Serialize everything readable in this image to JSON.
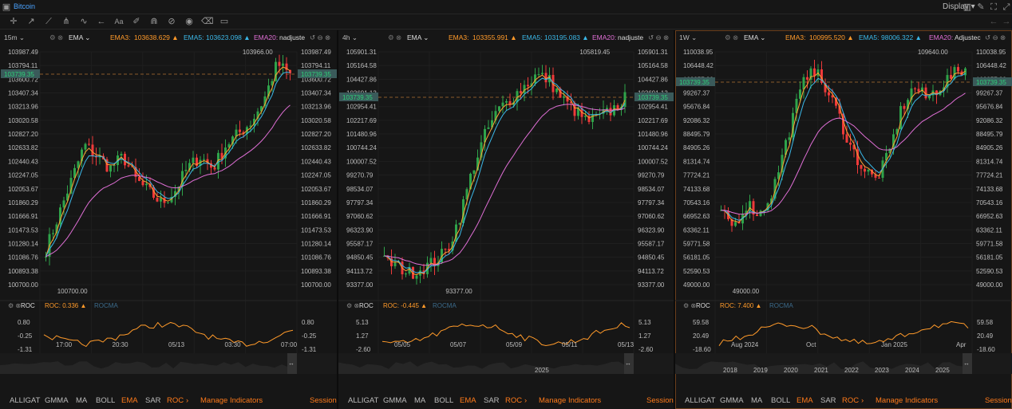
{
  "app": {
    "title": "Bitcoin",
    "display_label": "Display"
  },
  "colors": {
    "up": "#2fa44a",
    "down": "#ef3a3a",
    "ema3": "#ffa033",
    "ema5": "#3bb8e8",
    "ema20": "#e06fd6",
    "roc": "#ff9a2a",
    "accent": "#ff7a1a"
  },
  "toolbar_icons": [
    "crosshair-icon",
    "drag-icon",
    "trend-line-icon",
    "fork-icon",
    "zigzag-icon",
    "arrow-icon",
    "text-icon",
    "brush-icon",
    "magnet-icon",
    "lock-icon",
    "eye-icon",
    "trash-icon",
    "layers-icon"
  ],
  "bottom_items": [
    "ALLIGAT",
    "GMMA",
    "MA",
    "BOLL",
    "EMA",
    "SAR",
    "ROC",
    "›",
    "Manage Indicators",
    "Session"
  ],
  "panels": [
    {
      "timeframe": "15m",
      "ind_label": "EMA",
      "ema3": "EMA3:",
      "ema3v": "103638.629",
      "ema5": "EMA5:",
      "ema5v": "103623.098",
      "ema20": "EMA20:",
      "ema20v": "nadjuste",
      "prices": [
        "103987.49",
        "103794.11",
        "103600.72",
        "103407.34",
        "103213.96",
        "103020.58",
        "102827.20",
        "102633.82",
        "102440.43",
        "102247.05",
        "102053.67",
        "101860.29",
        "101666.91",
        "101473.53",
        "101280.14",
        "101086.76",
        "100893.38",
        "100700.00"
      ],
      "last_price": "103739.35",
      "high_label": "103966.00",
      "low_label": "100700.00",
      "roc_label": "ROC",
      "roc_v": "ROC: 0.336",
      "rocma": "ROCMA",
      "roc_ticks": [
        "0.80",
        "-0.25",
        "-1.31"
      ],
      "time_ticks": [
        "17:00",
        "20:30",
        "05/13",
        "03:30",
        "07:00"
      ],
      "year_ticks": []
    },
    {
      "timeframe": "4h",
      "ind_label": "EMA",
      "ema3": "EMA3:",
      "ema3v": "103355.991",
      "ema5": "EMA5:",
      "ema5v": "103195.083",
      "ema20": "EMA20:",
      "ema20v": "nadjuste",
      "prices": [
        "105901.31",
        "105164.58",
        "104427.86",
        "103691.13",
        "102954.41",
        "102217.69",
        "101480.96",
        "100744.24",
        "100007.52",
        "99270.79",
        "98534.07",
        "97797.34",
        "97060.62",
        "96323.90",
        "95587.17",
        "94850.45",
        "94113.72",
        "93377.00"
      ],
      "last_price": "103739.35",
      "high_label": "105819.45",
      "low_label": "93377.00",
      "roc_label": "ROC",
      "roc_v": "ROC: -0.445",
      "rocma": "ROCMA",
      "roc_ticks": [
        "5.13",
        "1.27",
        "-2.60"
      ],
      "time_ticks": [
        "05/05",
        "05/07",
        "05/09",
        "05/11",
        "05/13"
      ],
      "year_ticks": [
        "2025"
      ]
    },
    {
      "timeframe": "1W",
      "ind_label": "EMA",
      "ema3": "EMA3:",
      "ema3v": "100995.520",
      "ema5": "EMA5:",
      "ema5v": "98006.322",
      "ema20": "EMA20:",
      "ema20v": "Adjustec",
      "prices": [
        "110038.95",
        "106448.42",
        "102857.89",
        "99267.37",
        "95676.84",
        "92086.32",
        "88495.79",
        "84905.26",
        "81314.74",
        "77724.21",
        "74133.68",
        "70543.16",
        "66952.63",
        "63362.11",
        "59771.58",
        "56181.05",
        "52590.53",
        "49000.00"
      ],
      "last_price": "103739.35",
      "high_label": "109640.00",
      "low_label": "49000.00",
      "roc_label": "ROC",
      "roc_v": "ROC: 7.400",
      "rocma": "ROCMA",
      "roc_ticks": [
        "59.58",
        "20.49",
        "-18.60"
      ],
      "time_ticks": [
        "Aug 2024",
        "Oct",
        "Jan 2025",
        "Apr"
      ],
      "year_ticks": [
        "2018",
        "2019",
        "2020",
        "2021",
        "2022",
        "2023",
        "2024",
        "2025"
      ]
    }
  ]
}
